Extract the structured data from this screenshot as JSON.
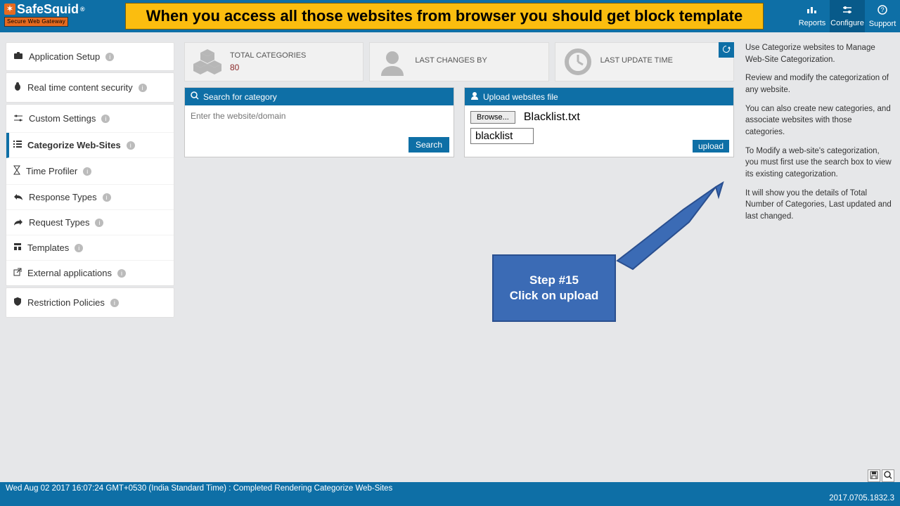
{
  "logo": {
    "name": "SafeSquid",
    "tagline": "Secure Web Gateway",
    "reg": "®"
  },
  "banner": "When you access all those websites from browser  you should get block template",
  "topnav": {
    "reports": "Reports",
    "configure": "Configure",
    "support": "Support"
  },
  "sidebar": {
    "app_setup": "Application Setup",
    "realtime": "Real time content security",
    "custom_settings": "Custom Settings",
    "items": [
      {
        "label": "Categorize Web-Sites"
      },
      {
        "label": "Time Profiler"
      },
      {
        "label": "Response Types"
      },
      {
        "label": "Request Types"
      },
      {
        "label": "Templates"
      },
      {
        "label": "External applications"
      }
    ],
    "restriction": "Restriction Policies"
  },
  "stats": {
    "total_label": "TOTAL CATEGORIES",
    "total_value": "80",
    "changes_label": "LAST CHANGES BY",
    "changes_value": "",
    "update_label": "LAST UPDATE TIME",
    "update_value": ""
  },
  "search": {
    "title": "Search for category",
    "placeholder": "Enter the website/domain",
    "button": "Search"
  },
  "upload": {
    "title": "Upload websites file",
    "browse_label": "Browse...",
    "filename": "Blacklist.txt",
    "category_value": "blacklist",
    "button": "upload"
  },
  "help": {
    "p1": "Use Categorize websites to Manage Web-Site Categorization.",
    "p2": "Review and modify the categorization of any website.",
    "p3": "You can also create new categories, and associate websites with those categories.",
    "p4": "To Modify a web-site's categorization, you must first use the search box to view its existing categorization.",
    "p5": "It will show you the details of Total Number of Categories, Last updated and last changed."
  },
  "callout": {
    "line1": "Step #15",
    "line2": "Click on upload"
  },
  "footer": {
    "status": "Wed Aug 02 2017 16:07:24 GMT+0530 (India Standard Time) : Completed Rendering Categorize Web-Sites",
    "version": "2017.0705.1832.3"
  },
  "icons": {
    "reports": "chart-icon",
    "configure": "sliders-icon",
    "support": "question-icon",
    "refresh": "refresh-icon",
    "search": "search-icon",
    "upload_user": "user-upload-icon",
    "save": "save-icon",
    "zoom": "zoom-icon"
  }
}
